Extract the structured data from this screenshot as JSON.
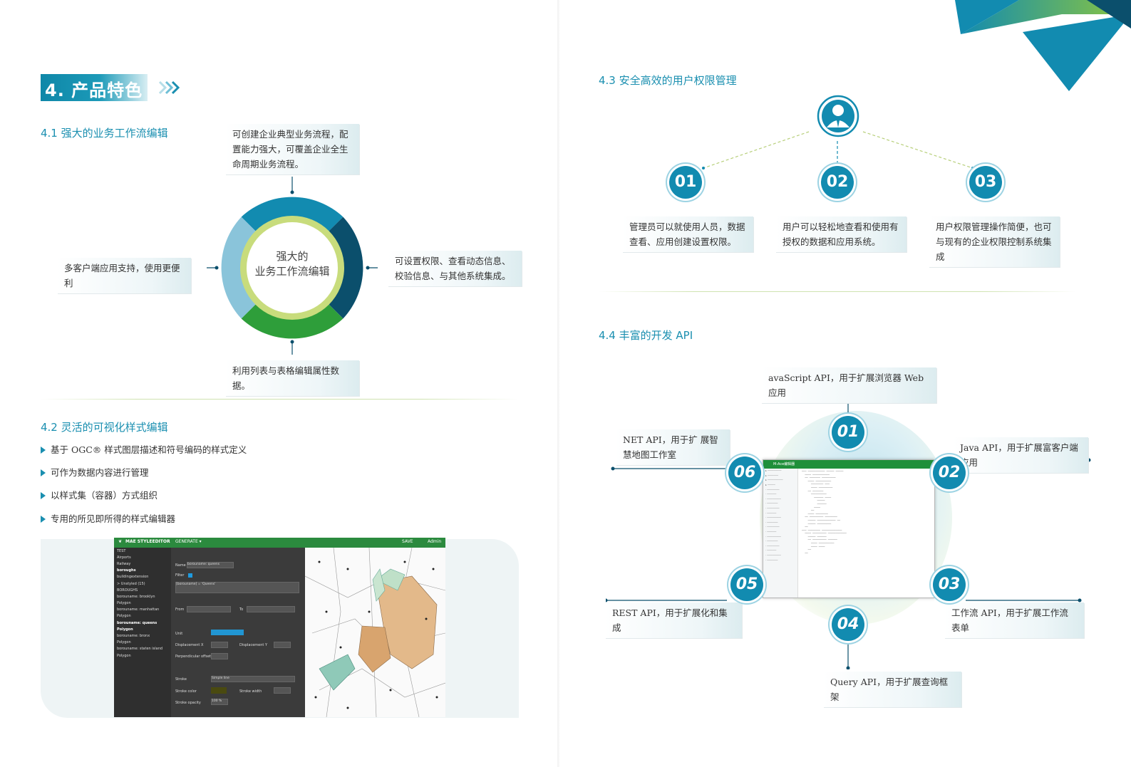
{
  "left": {
    "section_title": "4. 产品特色",
    "s41": {
      "title": "4.1 强大的业务工作流编辑",
      "center_line1": "强大的",
      "center_line2": "业务工作流编辑",
      "note_top": "可创建企业典型业务流程，配置能力强大，可覆盖企业全生命周期业务流程。",
      "note_left": "多客户端应用支持，使用更便利",
      "note_right": "可设置权限、查看动态信息、校验信息、与其他系统集成。",
      "note_bottom": "利用列表与表格编辑属性数据。"
    },
    "s42": {
      "title": "4.2 灵活的可视化样式编辑",
      "bullets": [
        "基于 OGC® 样式图层描述和符号编码的样式定义",
        "可作为数据内容进行管理",
        "以样式集（容器）方式组织",
        "专用的所见即所得的样式编辑器"
      ]
    },
    "app": {
      "brand": "MAE STYLEEDITOR",
      "menu": "GENERATE ▾",
      "save": "SAVE",
      "user": "Admin",
      "tree": [
        "TEST",
        "Airports",
        "Railway",
        "boroughs",
        "buildingextension",
        "> Unstyled (15)",
        "BOROUGHS",
        "borouname: brooklyn",
        "Polygon",
        "borouname: manhattan",
        "Polygon",
        "borouname: queens",
        "Polygon",
        "borouname: bronx",
        "Polygon",
        "borouname: staten island",
        "Polygon"
      ],
      "name_label": "Name",
      "name_value": "borouname: queens",
      "filter_label": "Filter",
      "filter_value": "[borouname] = 'Queens'",
      "from_label": "From",
      "to_label": "To",
      "unit_label": "Unit",
      "dx_label": "Displacement X",
      "dy_label": "Displacement Y",
      "perp_label": "Perpendicular offset",
      "stroke_label": "Stroke",
      "stroke_value": "Simple line",
      "stroke_color_label": "Stroke color",
      "stroke_width_label": "Stroke width",
      "stroke_opacity_label": "Stroke opacity",
      "stroke_opacity_value": "100 %"
    }
  },
  "right": {
    "s43": {
      "title": "4.3 安全高效的用户权限管理",
      "nums": [
        "01",
        "02",
        "03"
      ],
      "notes": [
        "管理员可以就使用人员，数据查看、应用创建设置权限。",
        "用户可以轻松地查看和使用有授权的数据和应用系统。",
        "用户权限管理操作简便，也可与现有的企业权限控制系统集成"
      ]
    },
    "s44": {
      "title": "4.4 丰富的开发 API",
      "nums": [
        "01",
        "02",
        "03",
        "04",
        "05",
        "06"
      ],
      "api01": "avaScript API，用于扩展浏览器 Web 应用",
      "api02": "Java API，用于扩展富客户端应用",
      "api03": "工作流 API，用于扩展工作流表单",
      "api04": "Query API，用于扩展查询框架",
      "api05": "REST API，用于扩展化和集成",
      "api06": "NET API，用于扩 展智慧地图工作室",
      "ide_title": "M-Ace编辑器"
    }
  },
  "colors": {
    "teal": "#128bb0",
    "dark_blue": "#0b4f6c",
    "light_blue": "#8ac4da",
    "green": "#2e9e3a",
    "lime_ring": "#c8dc7c"
  }
}
